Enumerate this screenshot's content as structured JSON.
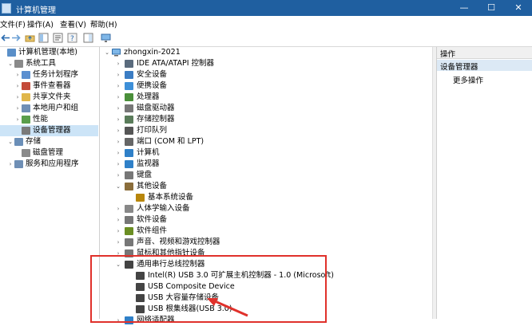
{
  "window": {
    "title": "计算机管理",
    "min": "—",
    "max": "☐",
    "close": "✕"
  },
  "menu": [
    "文件(F)",
    "操作(A)",
    "查看(V)",
    "帮助(H)"
  ],
  "left_tree": [
    {
      "label": "计算机管理(本地)",
      "depth": 0,
      "arrow": "",
      "icon": "computer-icon"
    },
    {
      "label": "系统工具",
      "depth": 1,
      "arrow": "⌄",
      "icon": "tools-icon"
    },
    {
      "label": "任务计划程序",
      "depth": 2,
      "arrow": "›",
      "icon": "clock-icon"
    },
    {
      "label": "事件查看器",
      "depth": 2,
      "arrow": "›",
      "icon": "event-icon"
    },
    {
      "label": "共享文件夹",
      "depth": 2,
      "arrow": "›",
      "icon": "folder-icon"
    },
    {
      "label": "本地用户和组",
      "depth": 2,
      "arrow": "›",
      "icon": "users-icon"
    },
    {
      "label": "性能",
      "depth": 2,
      "arrow": "›",
      "icon": "performance-icon"
    },
    {
      "label": "设备管理器",
      "depth": 2,
      "arrow": "",
      "icon": "device-manager-icon",
      "selected": true
    },
    {
      "label": "存储",
      "depth": 1,
      "arrow": "⌄",
      "icon": "storage-icon"
    },
    {
      "label": "磁盘管理",
      "depth": 2,
      "arrow": "",
      "icon": "disk-icon"
    },
    {
      "label": "服务和应用程序",
      "depth": 1,
      "arrow": "›",
      "icon": "services-icon"
    }
  ],
  "device_tree": {
    "root": "zhongxin-2021",
    "items": [
      {
        "label": "IDE ATA/ATAPI 控制器",
        "depth": 1,
        "arrow": "›",
        "color": "#5a6b7d"
      },
      {
        "label": "安全设备",
        "depth": 1,
        "arrow": "›",
        "color": "#3b7dc4"
      },
      {
        "label": "便携设备",
        "depth": 1,
        "arrow": "›",
        "color": "#3d8fd8"
      },
      {
        "label": "处理器",
        "depth": 1,
        "arrow": "›",
        "color": "#4a8f3a"
      },
      {
        "label": "磁盘驱动器",
        "depth": 1,
        "arrow": "›",
        "color": "#777777"
      },
      {
        "label": "存储控制器",
        "depth": 1,
        "arrow": "›",
        "color": "#5a7c5a"
      },
      {
        "label": "打印队列",
        "depth": 1,
        "arrow": "›",
        "color": "#555555"
      },
      {
        "label": "端口 (COM 和 LPT)",
        "depth": 1,
        "arrow": "›",
        "color": "#666666"
      },
      {
        "label": "计算机",
        "depth": 1,
        "arrow": "›",
        "color": "#2f80c8"
      },
      {
        "label": "监视器",
        "depth": 1,
        "arrow": "›",
        "color": "#2f80c8"
      },
      {
        "label": "键盘",
        "depth": 1,
        "arrow": "›",
        "color": "#777777"
      },
      {
        "label": "其他设备",
        "depth": 1,
        "arrow": "⌄",
        "color": "#8a6d3b"
      },
      {
        "label": "基本系统设备",
        "depth": 2,
        "arrow": "",
        "color": "#b8860b"
      },
      {
        "label": "人体学输入设备",
        "depth": 1,
        "arrow": "›",
        "color": "#888888"
      },
      {
        "label": "软件设备",
        "depth": 1,
        "arrow": "›",
        "color": "#777777"
      },
      {
        "label": "软件组件",
        "depth": 1,
        "arrow": "›",
        "color": "#6b8e23"
      },
      {
        "label": "声音、视频和游戏控制器",
        "depth": 1,
        "arrow": "›",
        "color": "#777777"
      },
      {
        "label": "鼠标和其他指针设备",
        "depth": 1,
        "arrow": "›",
        "color": "#777777"
      },
      {
        "label": "通用串行总线控制器",
        "depth": 1,
        "arrow": "⌄",
        "color": "#444444"
      },
      {
        "label": "Intel(R) USB 3.0 可扩展主机控制器 - 1.0 (Microsoft)",
        "depth": 2,
        "arrow": "",
        "color": "#444444"
      },
      {
        "label": "USB Composite Device",
        "depth": 2,
        "arrow": "",
        "color": "#444444"
      },
      {
        "label": "USB 大容量存储设备",
        "depth": 2,
        "arrow": "",
        "color": "#444444"
      },
      {
        "label": "USB 根集线器(USB 3.0)",
        "depth": 2,
        "arrow": "",
        "color": "#444444"
      },
      {
        "label": "网络适配器",
        "depth": 1,
        "arrow": "›",
        "color": "#2f80c8"
      }
    ]
  },
  "actions": {
    "header": "操作",
    "section": "设备管理器",
    "more": "更多操作"
  },
  "colors": {
    "title_bar": "#1f5fa0",
    "selection": "#cce4f7",
    "annotation": "#e0312b"
  }
}
